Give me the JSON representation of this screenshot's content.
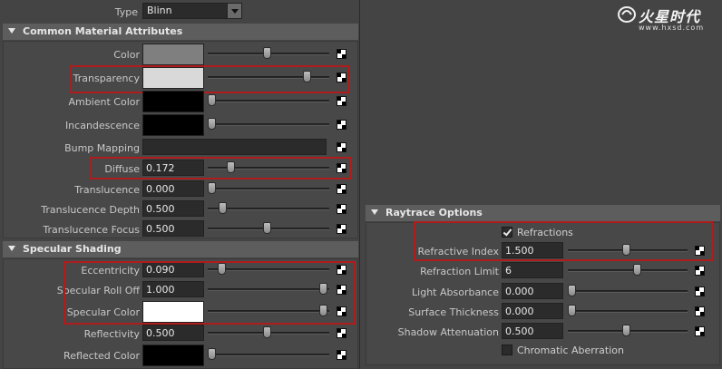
{
  "type_row": {
    "label": "Type",
    "value": "Blinn"
  },
  "sections": {
    "common": "Common Material Attributes",
    "specular": "Specular Shading",
    "raytrace": "Raytrace Options"
  },
  "common_attrs": {
    "color": {
      "label": "Color",
      "slider": 0.49
    },
    "transparency": {
      "label": "Transparency",
      "slider": 0.82
    },
    "ambient": {
      "label": "Ambient Color",
      "slider": 0.0
    },
    "incandescence": {
      "label": "Incandescence",
      "slider": 0.0
    },
    "bump": {
      "label": "Bump Mapping"
    },
    "diffuse": {
      "label": "Diffuse",
      "value": "0.172",
      "slider": 0.17
    },
    "translucence": {
      "label": "Translucence",
      "value": "0.000",
      "slider": 0.0
    },
    "translucence_depth": {
      "label": "Translucence Depth",
      "value": "0.500",
      "slider": 0.09
    },
    "translucence_focus": {
      "label": "Translucence Focus",
      "value": "0.500",
      "slider": 0.49
    }
  },
  "specular_attrs": {
    "eccentricity": {
      "label": "Eccentricity",
      "value": "0.090",
      "slider": 0.09
    },
    "roll_off": {
      "label": "Specular Roll Off",
      "value": "1.000",
      "slider": 1.0
    },
    "spec_color": {
      "label": "Specular Color",
      "slider": 1.0
    },
    "reflectivity": {
      "label": "Reflectivity",
      "value": "0.500",
      "slider": 0.49
    },
    "reflected_color": {
      "label": "Reflected Color",
      "slider": 0.0
    }
  },
  "raytrace_attrs": {
    "refractions": {
      "label": "Refractions",
      "checked": true
    },
    "refractive_index": {
      "label": "Refractive Index",
      "value": "1.500",
      "slider": 0.49
    },
    "refraction_limit": {
      "label": "Refraction Limit",
      "value": "6",
      "slider": 0.49
    },
    "light_absorbance": {
      "label": "Light Absorbance",
      "value": "0.000",
      "slider": 0.0
    },
    "surface_thickness": {
      "label": "Surface Thickness",
      "value": "0.000",
      "slider": 0.0
    },
    "shadow_attenuation": {
      "label": "Shadow Attenuation",
      "value": "0.500",
      "slider": 0.49
    },
    "chromatic": {
      "label": "Chromatic Aberration",
      "checked": false
    }
  },
  "logo": {
    "text": "火星时代",
    "url": "www.hxsd.com"
  },
  "colors": {
    "highlight": "#b01c1c",
    "color_swatch": "#7f7f7f",
    "transparency_swatch": "#d9d9d9",
    "black_swatch": "#000000",
    "white_swatch": "#ffffff"
  }
}
